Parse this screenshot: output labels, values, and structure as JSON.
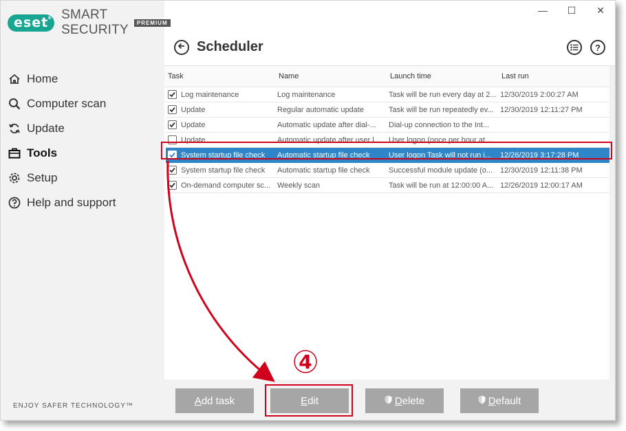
{
  "app": {
    "logo_badge": "eset",
    "logo_product": "SMART SECURITY",
    "logo_edition": "PREMIUM",
    "tagline": "ENJOY SAFER TECHNOLOGY™"
  },
  "window_controls": {
    "minimize": "—",
    "maximize": "☐",
    "close": "✕"
  },
  "sidebar": {
    "items": [
      {
        "label": "Home",
        "icon": "home-icon"
      },
      {
        "label": "Computer scan",
        "icon": "search-icon"
      },
      {
        "label": "Update",
        "icon": "refresh-icon"
      },
      {
        "label": "Tools",
        "icon": "briefcase-icon",
        "active": true
      },
      {
        "label": "Setup",
        "icon": "gear-icon"
      },
      {
        "label": "Help and support",
        "icon": "help-icon"
      }
    ]
  },
  "header": {
    "title": "Scheduler",
    "help_glyph": "?"
  },
  "table": {
    "columns": [
      "Task",
      "Name",
      "Launch time",
      "Last run"
    ],
    "rows": [
      {
        "checked": true,
        "task": "Log maintenance",
        "name": "Log maintenance",
        "launch": "Task will be run every day at 2...",
        "last_run": "12/30/2019 2:00:27 AM"
      },
      {
        "checked": true,
        "task": "Update",
        "name": "Regular automatic update",
        "launch": "Task will be run repeatedly ev...",
        "last_run": "12/30/2019 12:11:27 PM"
      },
      {
        "checked": true,
        "task": "Update",
        "name": "Automatic update after dial-...",
        "launch": "Dial-up connection to the Int...",
        "last_run": ""
      },
      {
        "checked": false,
        "task": "Update",
        "name": "Automatic update after user l...",
        "launch": "User logon (once per hour at...",
        "last_run": ""
      },
      {
        "checked": true,
        "task": "System startup file check",
        "name": "Automatic startup file check",
        "launch": "User logon Task will not run i...",
        "last_run": "12/26/2019 3:17:28 PM",
        "selected": true
      },
      {
        "checked": true,
        "task": "System startup file check",
        "name": "Automatic startup file check",
        "launch": "Successful module update (o...",
        "last_run": "12/30/2019 12:11:38 PM"
      },
      {
        "checked": true,
        "task": "On-demand computer sc...",
        "name": "Weekly scan",
        "launch": "Task will be run at 12:00:00 A...",
        "last_run": "12/26/2019 12:00:17 AM"
      }
    ]
  },
  "footer": {
    "add_task": {
      "first": "A",
      "rest": "dd task"
    },
    "edit": {
      "first": "E",
      "rest": "dit"
    },
    "delete": {
      "first": "D",
      "rest": "elete"
    },
    "default": {
      "first": "D",
      "rest": "efault"
    }
  },
  "annotation": {
    "step": "4",
    "color": "#d0021b"
  },
  "colors": {
    "brand": "#18a592",
    "selection": "#2e86c9",
    "button": "#a6a6a6"
  }
}
